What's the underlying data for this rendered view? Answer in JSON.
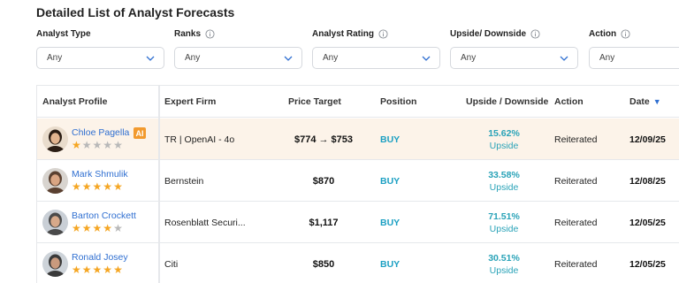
{
  "title": "Detailed List of Analyst Forecasts",
  "filters": [
    {
      "label": "Analyst Type",
      "info": false,
      "value": "Any"
    },
    {
      "label": "Ranks",
      "info": true,
      "value": "Any"
    },
    {
      "label": "Analyst Rating",
      "info": true,
      "value": "Any"
    },
    {
      "label": "Upside/ Downside",
      "info": true,
      "value": "Any"
    },
    {
      "label": "Action",
      "info": true,
      "value": "Any"
    }
  ],
  "table": {
    "headers": {
      "analyst_profile": "Analyst Profile",
      "expert_firm": "Expert Firm",
      "price_target": "Price Target",
      "position": "Position",
      "upside_downside": "Upside / Downside",
      "action": "Action",
      "date": "Date"
    },
    "sort_indicator": "▼",
    "rows": [
      {
        "analyst": "Chloe Pagella",
        "ai_badge": "AI",
        "stars": 1,
        "firm": "TR | OpenAI - 4o",
        "price_target": "$774 → $753",
        "position": "BUY",
        "upside_pct": "15.62%",
        "upside_label": "Upside",
        "action": "Reiterated",
        "date": "12/09/25",
        "highlight": true
      },
      {
        "analyst": "Mark Shmulik",
        "ai_badge": "",
        "stars": 5,
        "firm": "Bernstein",
        "price_target": "$870",
        "position": "BUY",
        "upside_pct": "33.58%",
        "upside_label": "Upside",
        "action": "Reiterated",
        "date": "12/08/25",
        "highlight": false
      },
      {
        "analyst": "Barton Crockett",
        "ai_badge": "",
        "stars": 4,
        "firm": "Rosenblatt Securi...",
        "price_target": "$1,117",
        "position": "BUY",
        "upside_pct": "71.51%",
        "upside_label": "Upside",
        "action": "Reiterated",
        "date": "12/05/25",
        "highlight": false
      },
      {
        "analyst": "Ronald Josey",
        "ai_badge": "",
        "stars": 5,
        "firm": "Citi",
        "price_target": "$850",
        "position": "BUY",
        "upside_pct": "30.51%",
        "upside_label": "Upside",
        "action": "Reiterated",
        "date": "12/05/25",
        "highlight": false
      }
    ]
  },
  "colors": {
    "star_on": "#f5a623",
    "star_off": "#b8b8b8",
    "link": "#2f6fd1",
    "buy": "#1a9fc2",
    "upside": "#2aa3b8",
    "highlight_row": "#fcf3e9",
    "ai_badge": "#f29a2e"
  },
  "icons": {
    "info": "info-circle-icon",
    "dropdown": "chevron-down-icon",
    "sort": "sort-desc-icon",
    "star": "star-icon"
  }
}
